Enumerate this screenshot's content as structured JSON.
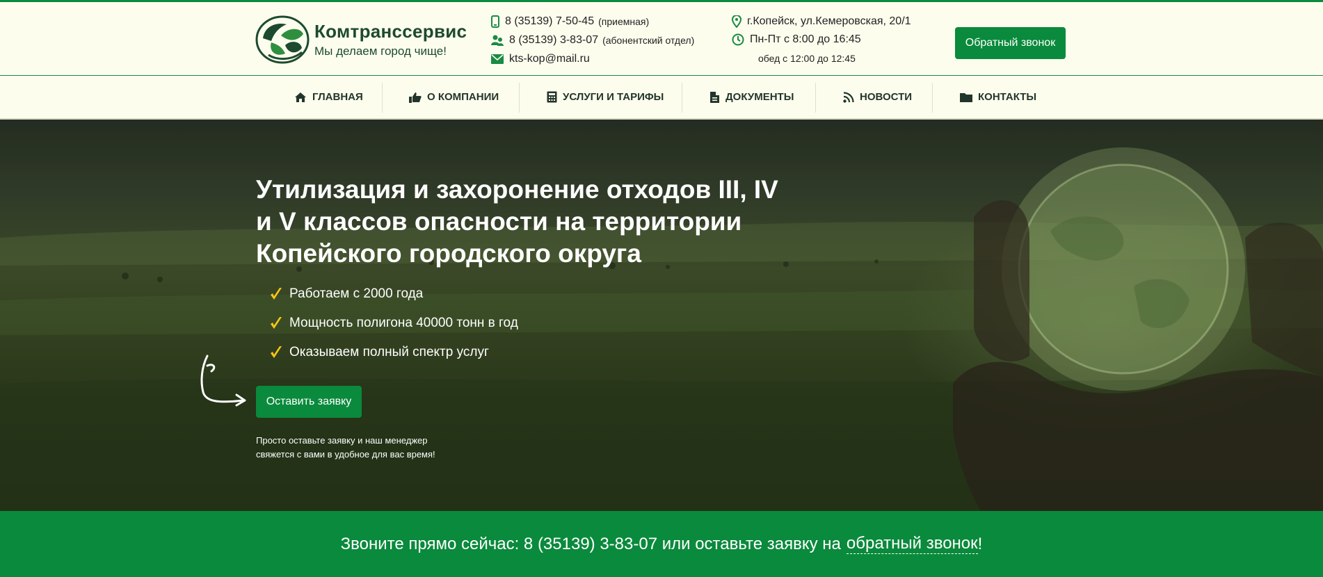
{
  "brand": {
    "title": "Комтранссервис",
    "slogan": "Мы делаем город чище!",
    "colors": {
      "primary": "#0a8a3c",
      "dark": "#1d4a2e",
      "header_bg": "#fdfdee",
      "check": "#f7c614"
    }
  },
  "contacts": {
    "phone1": {
      "number": "8 (35139) 7-50-45",
      "note": "(приемная)",
      "icon": "phone-icon"
    },
    "phone2": {
      "number": "8 (35139) 3-83-07",
      "note": "(абонентский отдел)",
      "icon": "users-icon"
    },
    "email": {
      "value": "kts-kop@mail.ru",
      "icon": "mail-icon"
    },
    "address": {
      "value": "г.Копейск, ул.Кемеровская, 20/1",
      "icon": "map-pin-icon"
    },
    "hours": {
      "value": "Пн-Пт с 8:00 до 16:45",
      "icon": "clock-icon"
    },
    "lunch": "обед с 12:00 до 12:45"
  },
  "header": {
    "callback_label": "Обратный звонок"
  },
  "nav": {
    "items": [
      {
        "label": "ГЛАВНАЯ",
        "icon": "home-icon"
      },
      {
        "label": "О КОМПАНИИ",
        "icon": "thumbs-up-icon"
      },
      {
        "label": "УСЛУГИ И ТАРИФЫ",
        "icon": "calculator-icon"
      },
      {
        "label": "ДОКУМЕНТЫ",
        "icon": "document-icon"
      },
      {
        "label": "НОВОСТИ",
        "icon": "rss-icon"
      },
      {
        "label": "КОНТАКТЫ",
        "icon": "folder-icon"
      }
    ]
  },
  "hero": {
    "title_line1": "Утилизация и захоронение отходов III, IV",
    "title_line2": "и V классов опасности на территории",
    "title_line3": "Копейского городского округа",
    "bullets": [
      "Работаем с 2000 года",
      "Мощность полигона 40000 тонн в год",
      "Оказываем полный спектр услуг"
    ],
    "order_label": "Оставить заявку",
    "hint_line1": "Просто оставьте заявку и наш менеджер",
    "hint_line2": "свяжется с вами в удобное для вас время!"
  },
  "band": {
    "text": "Звоните прямо сейчас: 8 (35139) 3-83-07 или оставьте заявку на",
    "link": "обратный звонок",
    "suffix": "!"
  }
}
